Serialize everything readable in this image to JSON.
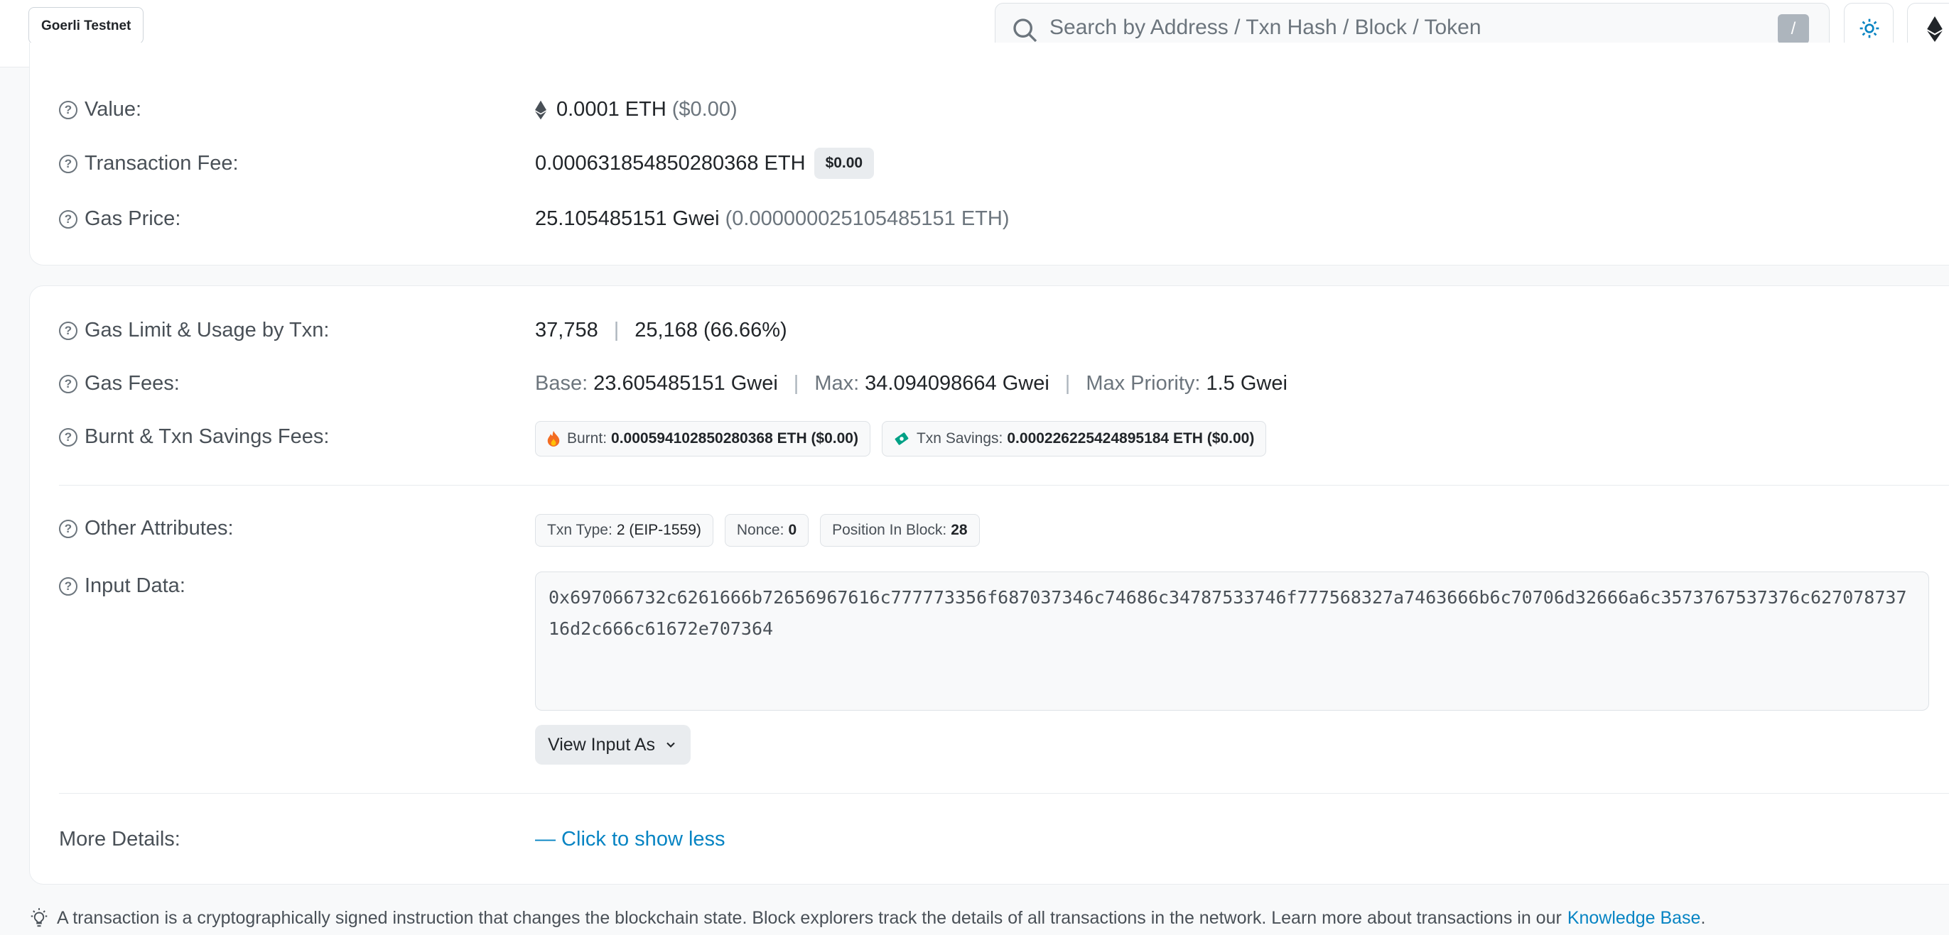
{
  "header": {
    "network_badge": "Goerli Testnet",
    "search_placeholder": "Search by Address / Txn Hash / Block / Token",
    "search_shortcut": "/"
  },
  "summary": {
    "value": {
      "label": "Value:",
      "amount": "0.0001 ETH",
      "usd": "($0.00)"
    },
    "fee": {
      "label": "Transaction Fee:",
      "amount": "0.000631854850280368 ETH",
      "usd_badge": "$0.00"
    },
    "gas_price": {
      "label": "Gas Price:",
      "gwei": "25.105485151 Gwei",
      "eth": "(0.000000025105485151 ETH)"
    }
  },
  "details": {
    "gas_limit": {
      "label": "Gas Limit & Usage by Txn:",
      "limit": "37,758",
      "separator": "|",
      "usage": "25,168 (66.66%)"
    },
    "gas_fees": {
      "label": "Gas Fees:",
      "base_label": "Base:",
      "base_value": "23.605485151 Gwei",
      "max_label": "Max:",
      "max_value": "34.094098664 Gwei",
      "priority_label": "Max Priority:",
      "priority_value": "1.5 Gwei",
      "separator": "|"
    },
    "burnt": {
      "label": "Burnt & Txn Savings Fees:",
      "burnt_key": "Burnt:",
      "burnt_value": "0.000594102850280368 ETH ($0.00)",
      "savings_key": "Txn Savings:",
      "savings_value": "0.000226225424895184 ETH ($0.00)"
    },
    "other": {
      "label": "Other Attributes:",
      "type_key": "Txn Type:",
      "type_value": "2 (EIP-1559)",
      "nonce_key": "Nonce:",
      "nonce_value": "0",
      "position_key": "Position In Block:",
      "position_value": "28"
    },
    "input": {
      "label": "Input Data:",
      "value": "0x697066732c6261666b72656967616c777773356f687037346c74686c34787533746f777568327a7463666b6c70706d32666a6c3573767537376c62707873716d2c666c61672e707364",
      "view_button": "View Input As"
    },
    "more": {
      "label": "More Details:",
      "link": "— Click to show less"
    }
  },
  "footer": {
    "text": "A transaction is a cryptographically signed instruction that changes the blockchain state. Block explorers track the details of all transactions in the network. Learn more about transactions in our",
    "link": "Knowledge Base",
    "end": "."
  },
  "colors": {
    "link": "#0784c3",
    "burnt_icon": "#f36c21",
    "savings_icon": "#00a186",
    "theme_icon": "#0784c3"
  },
  "icons": [
    "search-icon",
    "sun-icon",
    "ethereum-icon",
    "question-icon",
    "fire-icon",
    "savings-icon",
    "chevron-down-icon",
    "lightbulb-icon"
  ]
}
